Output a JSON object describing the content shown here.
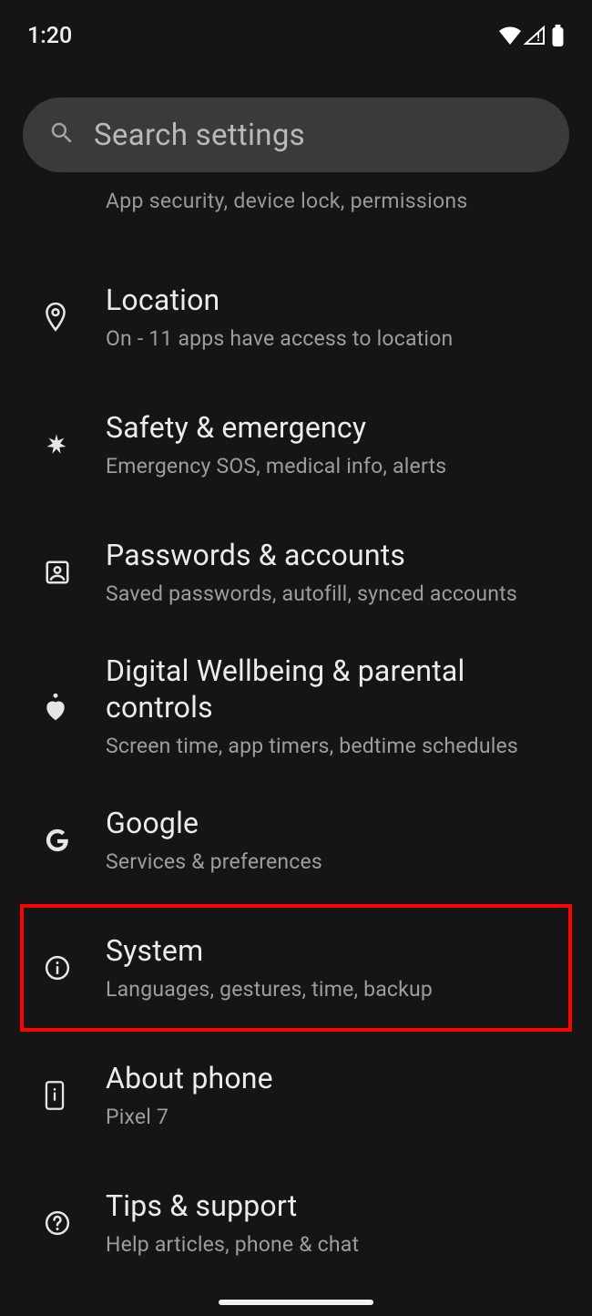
{
  "status": {
    "time": "1:20"
  },
  "search": {
    "placeholder": "Search settings"
  },
  "truncated_subtitle": "App security, device lock, permissions",
  "items": [
    {
      "title": "Location",
      "subtitle": "On - 11 apps have access to location"
    },
    {
      "title": "Safety & emergency",
      "subtitle": "Emergency SOS, medical info, alerts"
    },
    {
      "title": "Passwords & accounts",
      "subtitle": "Saved passwords, autofill, synced accounts"
    },
    {
      "title": "Digital Wellbeing & parental controls",
      "subtitle": "Screen time, app timers, bedtime schedules"
    },
    {
      "title": "Google",
      "subtitle": "Services & preferences"
    },
    {
      "title": "System",
      "subtitle": "Languages, gestures, time, backup"
    },
    {
      "title": "About phone",
      "subtitle": "Pixel 7"
    },
    {
      "title": "Tips & support",
      "subtitle": "Help articles, phone & chat"
    }
  ]
}
